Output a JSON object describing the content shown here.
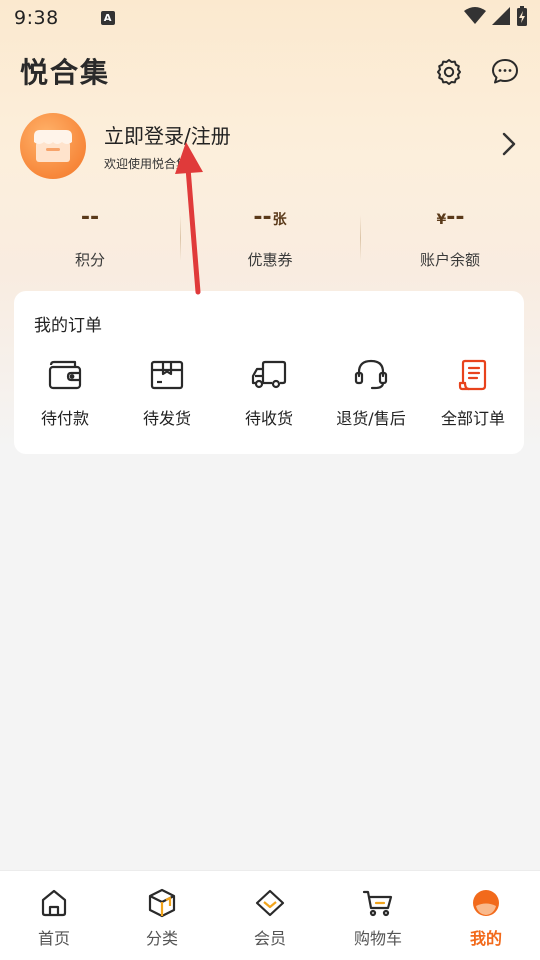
{
  "status": {
    "time": "9:38",
    "a_badge": "A"
  },
  "header": {
    "logo": "悦合集",
    "settings_icon": "gear-icon",
    "message_icon": "chat-bubble-icon"
  },
  "profile": {
    "title": "立即登录/注册",
    "subtitle": "欢迎使用悦合集"
  },
  "stats": [
    {
      "value": "--",
      "unit": "",
      "label": "积分"
    },
    {
      "value": "--",
      "unit": "张",
      "label": "优惠券"
    },
    {
      "value": "--",
      "unit": "",
      "prefix": "¥",
      "label": "账户余额"
    }
  ],
  "orders": {
    "title": "我的订单",
    "items": [
      {
        "label": "待付款",
        "icon": "wallet-icon"
      },
      {
        "label": "待发货",
        "icon": "package-box-icon"
      },
      {
        "label": "待收货",
        "icon": "delivery-truck-icon"
      },
      {
        "label": "退货/售后",
        "icon": "headset-icon"
      },
      {
        "label": "全部订单",
        "icon": "order-list-icon"
      }
    ]
  },
  "tabs": [
    {
      "label": "首页",
      "icon": "home-icon",
      "active": false
    },
    {
      "label": "分类",
      "icon": "category-cube-icon",
      "active": false
    },
    {
      "label": "会员",
      "icon": "member-diamond-icon",
      "active": false
    },
    {
      "label": "购物车",
      "icon": "cart-icon",
      "active": false
    },
    {
      "label": "我的",
      "icon": "profile-icon",
      "active": true
    }
  ],
  "colors": {
    "accent": "#f26a1b",
    "stat_value": "#5a3a1a",
    "annotation_arrow": "#e03a3a"
  }
}
